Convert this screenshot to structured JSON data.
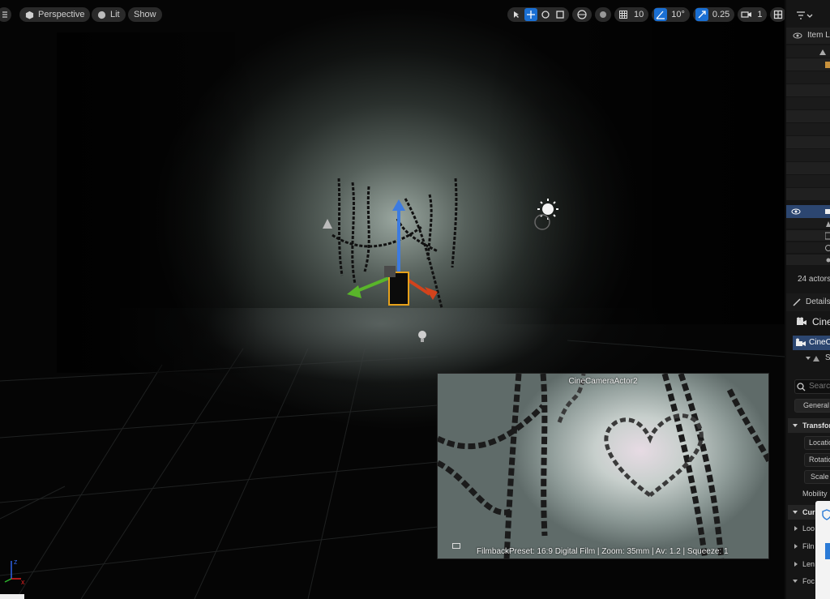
{
  "viewport": {
    "mode": {
      "label": "Perspective",
      "icon": "cube-icon"
    },
    "lighting": {
      "label": "Lit",
      "icon": "sphere-icon"
    },
    "show": {
      "label": "Show"
    },
    "toolbar": {
      "tools": [
        "select-icon",
        "translate-icon",
        "rotate-icon",
        "scale-icon"
      ],
      "grid_snap": "10",
      "rotation_snap": "10°",
      "scale_snap": "0.25",
      "camera_speed": "1"
    },
    "camera_preview": {
      "title": "CineCameraActor2",
      "info": "FilmbackPreset: 16:9 Digital Film | Zoom: 35mm | Av: 1.2 | Squeeze: 1"
    },
    "axis": {
      "x": "x",
      "z": "z"
    }
  },
  "outliner": {
    "header": "Item L",
    "actor_count": "24 actors"
  },
  "details": {
    "header": "Details",
    "actor_name": "Cine",
    "component": "CineC",
    "subcomponent": "S",
    "search_placeholder": "Searc",
    "tab_general": "General",
    "sections": {
      "transform": "Transfor",
      "location": "Locatio",
      "rotation": "Rotatio",
      "scale": "Scale",
      "mobility": "Mobility",
      "current": "Cur",
      "lookat": "Loo",
      "filmback": "Filn",
      "lens": "Len",
      "focus": "Foc"
    }
  },
  "colors": {
    "accent": "#1a6fd3",
    "selected_row": "#2c4670",
    "panel_bg": "#151515"
  }
}
